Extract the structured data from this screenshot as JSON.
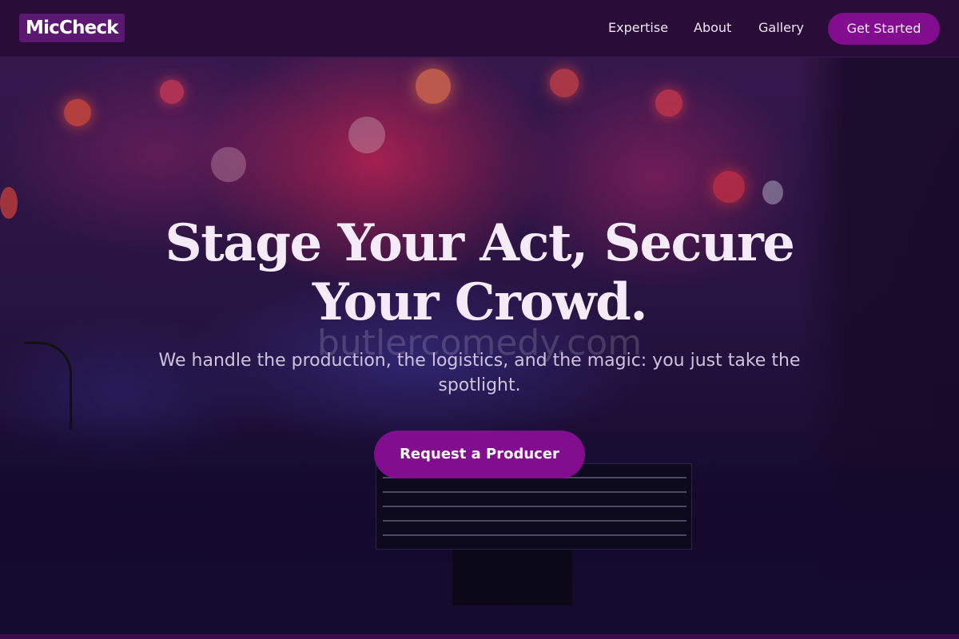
{
  "navbar": {
    "logo": "MicCheck",
    "links": [
      {
        "label": "Expertise"
      },
      {
        "label": "About"
      },
      {
        "label": "Gallery"
      }
    ],
    "cta_label": "Get Started"
  },
  "hero": {
    "title": "Stage Your Act, Secure Your Crowd.",
    "subtitle": "We handle the production, the logistics, and the magic: you just take the spotlight.",
    "watermark": "butlercomedy.com",
    "cta_label": "Request a Producer"
  },
  "colors": {
    "navbar_bg": "#2a0c39",
    "accent": "#820d8f",
    "logo_bg": "#5a1870",
    "title_text": "#f4eaf8",
    "subtitle_text": "#cfc3dc"
  }
}
